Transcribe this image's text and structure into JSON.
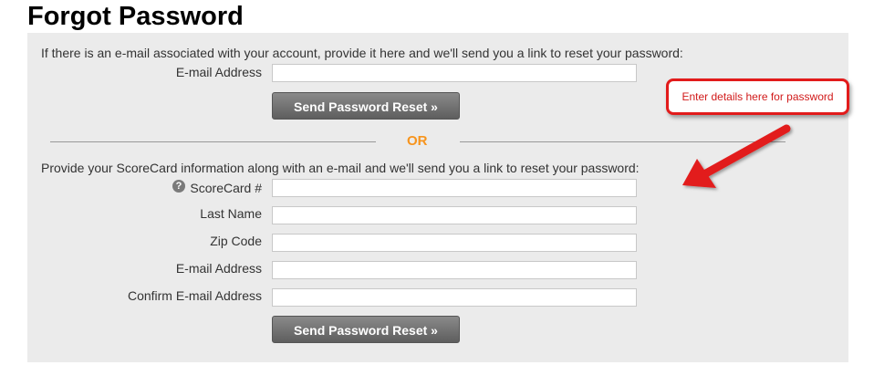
{
  "page": {
    "title": "Forgot Password"
  },
  "email_section": {
    "intro": "If there is an e-mail associated with your account, provide it here and we'll send you a link to reset your password:",
    "email_label": "E-mail Address",
    "email_value": "",
    "submit_label": "Send Password Reset »"
  },
  "divider": {
    "text": "OR"
  },
  "scorecard_section": {
    "intro": "Provide your ScoreCard information along with an e-mail and we'll send you a link to reset your password:",
    "help_icon_glyph": "?",
    "fields": [
      {
        "label": "ScoreCard #",
        "value": ""
      },
      {
        "label": "Last Name",
        "value": ""
      },
      {
        "label": "Zip Code",
        "value": ""
      },
      {
        "label": "E-mail Address",
        "value": ""
      },
      {
        "label": "Confirm E-mail Address",
        "value": ""
      }
    ],
    "submit_label": "Send Password Reset »"
  },
  "annotation": {
    "text": "Enter details here for password",
    "color": "#e21b1b"
  },
  "colors": {
    "panel_bg": "#ebebeb",
    "or_accent": "#f7941d",
    "button_bg": "#6e6e6e"
  }
}
